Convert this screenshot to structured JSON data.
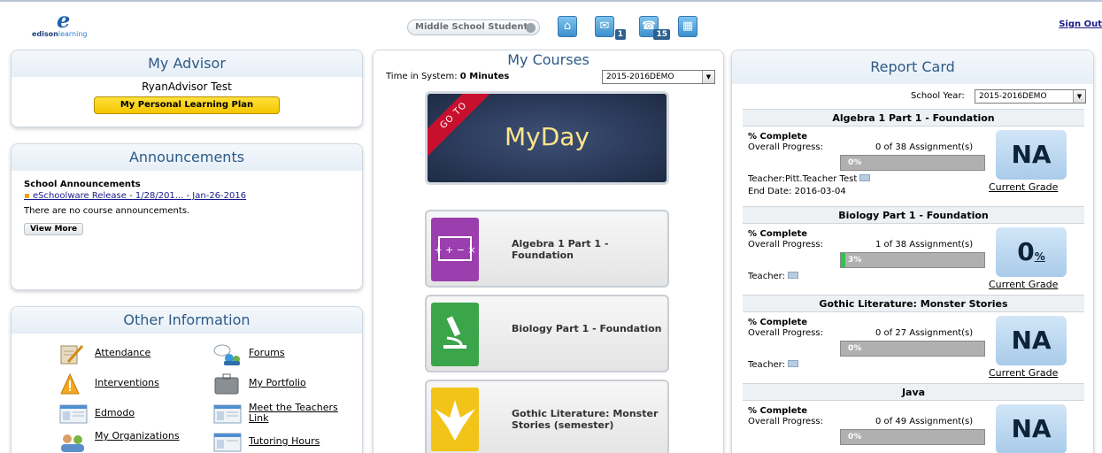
{
  "header": {
    "logo_mark": "e",
    "logo_word_bold": "edison",
    "logo_word_light": "learning",
    "user_pill": "Middle School Student",
    "nav": [
      {
        "icon": "home-icon",
        "glyph": "⌂",
        "badge": ""
      },
      {
        "icon": "inbox-icon",
        "glyph": "✉",
        "badge": "1"
      },
      {
        "icon": "notification-icon",
        "glyph": "☎",
        "badge": "15"
      },
      {
        "icon": "calendar-icon",
        "glyph": "▦",
        "badge": ""
      }
    ],
    "sign_out": "Sign Out"
  },
  "advisor": {
    "title": "My Advisor",
    "name": "RyanAdvisor Test",
    "plp_button": "My Personal Learning Plan"
  },
  "announcements": {
    "title": "Announcements",
    "school_heading": "School Announcements",
    "link": "eSchoolware Release - 1/28/201... - Jan-26-2016",
    "none_text": "There are no course announcements.",
    "view_more": "View More"
  },
  "other": {
    "title": "Other Information",
    "items": [
      {
        "label": "Attendance",
        "icon": "attendance-icon"
      },
      {
        "label": "Forums",
        "icon": "forums-icon"
      },
      {
        "label": "Interventions",
        "icon": "interventions-icon"
      },
      {
        "label": "My Portfolio",
        "icon": "portfolio-icon"
      },
      {
        "label": "Edmodo",
        "icon": "edmodo-icon"
      },
      {
        "label": "Meet the Teachers Link",
        "icon": "meet-teachers-icon"
      },
      {
        "label": "My Organizations",
        "icon": "organizations-icon"
      },
      {
        "label": "Tutoring Hours",
        "icon": "tutoring-icon"
      }
    ]
  },
  "courses": {
    "title": "My Courses",
    "time_label": "Time in System: ",
    "time_value": "0 Minutes",
    "year_select": "2015-2016DEMO",
    "myday_ribbon": "GO TO",
    "myday_text": "MyDay",
    "list": [
      {
        "name": "Algebra 1 Part 1 - Foundation",
        "icon": "math-icon",
        "color": "#9b3fae"
      },
      {
        "name": "Biology Part 1 - Foundation",
        "icon": "microscope-icon",
        "color": "#3aa54a"
      },
      {
        "name": "Gothic Literature: Monster Stories (semester)",
        "icon": "phoenix-icon",
        "color": "#f2c318"
      }
    ]
  },
  "report": {
    "title": "Report Card",
    "school_year_label": "School Year:",
    "school_year_value": "2015-2016DEMO",
    "pct_complete_label": "% Complete",
    "overall_label": "Overall Progress:",
    "current_grade_label": "Current Grade",
    "sections": [
      {
        "course": "Algebra 1 Part 1 - Foundation",
        "assignments": "0 of 38 Assignment(s)",
        "progress": 0,
        "progress_text": "0%",
        "teacher": "Teacher:Pitt.Teacher Test",
        "end_date": "End Date: 2016-03-04",
        "grade": "NA",
        "grade_pct": ""
      },
      {
        "course": "Biology Part 1 - Foundation",
        "assignments": "1 of 38 Assignment(s)",
        "progress": 3,
        "progress_text": "3%",
        "teacher": "Teacher:",
        "end_date": "",
        "grade": "0",
        "grade_pct": "%"
      },
      {
        "course": "Gothic Literature: Monster Stories",
        "assignments": "0 of 27 Assignment(s)",
        "progress": 0,
        "progress_text": "0%",
        "teacher": "Teacher:",
        "end_date": "",
        "grade": "NA",
        "grade_pct": ""
      },
      {
        "course": "Java",
        "assignments": "0 of 49 Assignment(s)",
        "progress": 0,
        "progress_text": "0%",
        "teacher": "",
        "end_date": "",
        "grade": "NA",
        "grade_pct": ""
      }
    ]
  }
}
